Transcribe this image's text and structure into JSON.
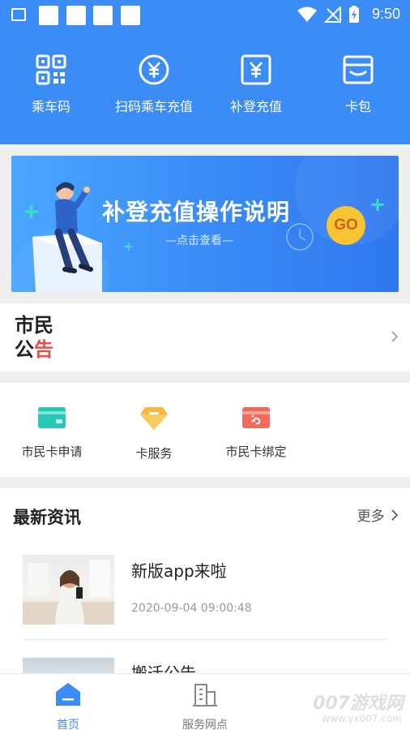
{
  "status_bar": {
    "time": "9:50"
  },
  "quick_actions": [
    {
      "label": "乘车码",
      "icon": "qr-code-icon"
    },
    {
      "label": "扫码乘车充值",
      "icon": "yen-circle-icon"
    },
    {
      "label": "补登充值",
      "icon": "yen-square-icon"
    },
    {
      "label": "卡包",
      "icon": "card-wallet-icon"
    }
  ],
  "banner": {
    "title": "补登充值操作说明",
    "subtitle": "—点击查看—",
    "go_label": "GO"
  },
  "notice": {
    "line1": "市民",
    "line2a": "公",
    "line2b": "告"
  },
  "services": [
    {
      "label": "市民卡申请",
      "icon": "card-apply-icon",
      "color": "#29c7b8"
    },
    {
      "label": "卡服务",
      "icon": "diamond-service-icon",
      "color": "#f6b840"
    },
    {
      "label": "市民卡绑定",
      "icon": "card-bind-icon",
      "color": "#f16a5a"
    }
  ],
  "news": {
    "heading": "最新资讯",
    "more": "更多",
    "items": [
      {
        "title": "新版app来啦",
        "time": "2020-09-04 09:00:48"
      },
      {
        "title": "搬迁公告"
      }
    ]
  },
  "bottom_nav": [
    {
      "label": "首页",
      "active": true
    },
    {
      "label": "服务网点",
      "active": false
    }
  ],
  "watermark": {
    "main": "007游戏网",
    "sub": "www.yx007.com"
  },
  "colors": {
    "primary": "#3b8cf5",
    "accent_red": "#e8504a"
  }
}
